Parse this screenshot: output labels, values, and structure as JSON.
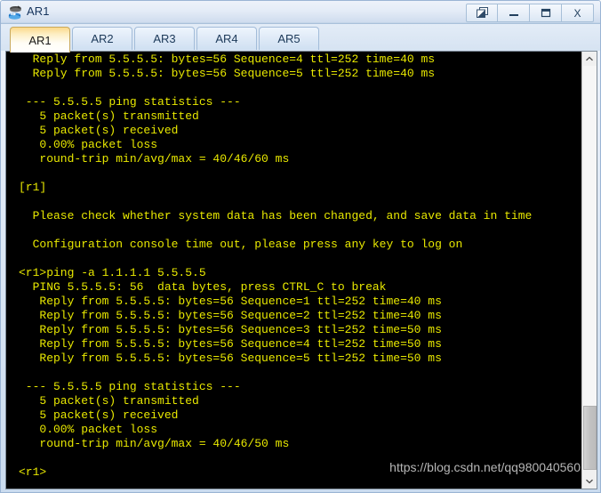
{
  "window": {
    "title": "AR1",
    "icon": "router-device-icon",
    "controls": [
      {
        "name": "restore-button",
        "glyph": "❐",
        "label": "Restore"
      },
      {
        "name": "minimize-button",
        "glyph": "_",
        "label": "Minimize"
      },
      {
        "name": "maximize-button",
        "glyph": "▭",
        "label": "Maximize"
      },
      {
        "name": "close-button",
        "glyph": "X",
        "label": "Close"
      }
    ]
  },
  "tabs": {
    "active_index": 0,
    "items": [
      {
        "label": "AR1"
      },
      {
        "label": "AR2"
      },
      {
        "label": "AR3"
      },
      {
        "label": "AR4"
      },
      {
        "label": "AR5"
      }
    ]
  },
  "terminal": {
    "foreground_color": "#e8e800",
    "background_color": "#000000",
    "lines": [
      "  Reply from 5.5.5.5: bytes=56 Sequence=4 ttl=252 time=40 ms",
      "  Reply from 5.5.5.5: bytes=56 Sequence=5 ttl=252 time=40 ms",
      "",
      " --- 5.5.5.5 ping statistics ---",
      "   5 packet(s) transmitted",
      "   5 packet(s) received",
      "   0.00% packet loss",
      "   round-trip min/avg/max = 40/46/60 ms",
      "",
      "[r1]",
      "",
      "  Please check whether system data has been changed, and save data in time",
      "",
      "  Configuration console time out, please press any key to log on",
      "",
      "<r1>ping -a 1.1.1.1 5.5.5.5",
      "  PING 5.5.5.5: 56  data bytes, press CTRL_C to break",
      "   Reply from 5.5.5.5: bytes=56 Sequence=1 ttl=252 time=40 ms",
      "   Reply from 5.5.5.5: bytes=56 Sequence=2 ttl=252 time=40 ms",
      "   Reply from 5.5.5.5: bytes=56 Sequence=3 ttl=252 time=50 ms",
      "   Reply from 5.5.5.5: bytes=56 Sequence=4 ttl=252 time=50 ms",
      "   Reply from 5.5.5.5: bytes=56 Sequence=5 ttl=252 time=50 ms",
      "",
      " --- 5.5.5.5 ping statistics ---",
      "   5 packet(s) transmitted",
      "   5 packet(s) received",
      "   0.00% packet loss",
      "   round-trip min/avg/max = 40/46/50 ms",
      "",
      "<r1>"
    ]
  },
  "watermark": {
    "text": "https://blog.csdn.net/qq980040560"
  },
  "scrollbar": {
    "up_glyph": "⌃",
    "down_glyph": "⌄"
  }
}
